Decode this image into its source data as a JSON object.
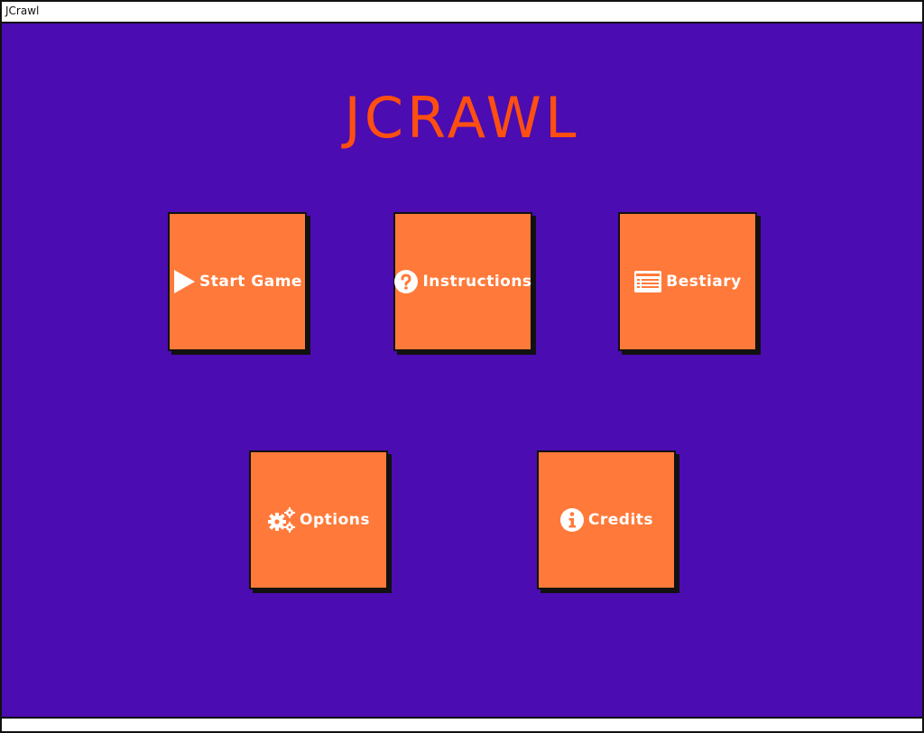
{
  "window": {
    "title": "JCrawl"
  },
  "app": {
    "title": "JCRAWL",
    "title_color": "#ff4f10",
    "background_color": "#4b0cb1",
    "tile_color": "#ff7a3a"
  },
  "menu": {
    "start_game": {
      "label": "Start Game",
      "icon": "play-icon"
    },
    "instructions": {
      "label": "Instructions",
      "icon": "question-circle-icon"
    },
    "bestiary": {
      "label": "Bestiary",
      "icon": "list-card-icon"
    },
    "options": {
      "label": "Options",
      "icon": "gears-icon"
    },
    "credits": {
      "label": "Credits",
      "icon": "info-circle-icon"
    }
  }
}
